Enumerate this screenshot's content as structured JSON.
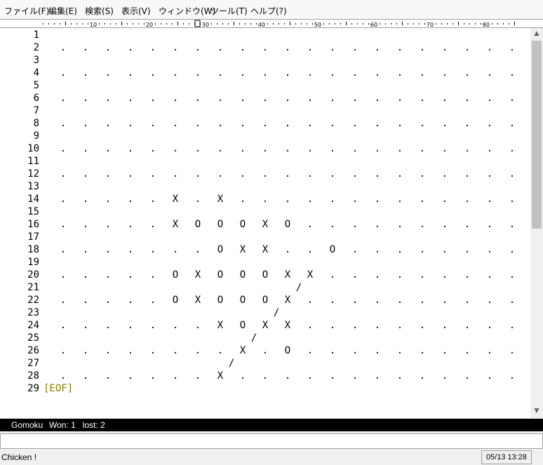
{
  "menu": [
    {
      "label": "ファイル(F)"
    },
    {
      "label": "編集(E)"
    },
    {
      "label": "検索(S)"
    },
    {
      "label": "表示(V)"
    },
    {
      "label": "ウィンドウ(W)"
    },
    {
      "label": "ツール(T)"
    },
    {
      "label": "ヘルプ(?)"
    }
  ],
  "ruler": {
    "labels": [
      "10",
      "20",
      "30",
      "40",
      "50",
      "60",
      "70",
      "80"
    ]
  },
  "editor": {
    "line_numbers": [
      "1",
      "2",
      "3",
      "4",
      "5",
      "6",
      "7",
      "8",
      "9",
      "10",
      "11",
      "12",
      "13",
      "14",
      "15",
      "16",
      "17",
      "18",
      "19",
      "20",
      "21",
      "22",
      "23",
      "24",
      "25",
      "26",
      "27",
      "28",
      "29"
    ],
    "board": {
      "symbols": [
        {
          "line": 14,
          "col": 5,
          "text": "X"
        },
        {
          "line": 14,
          "col": 7,
          "text": "X"
        },
        {
          "line": 16,
          "col": 5,
          "text": "X"
        },
        {
          "line": 16,
          "col": 6,
          "text": "O"
        },
        {
          "line": 16,
          "col": 7,
          "text": "O"
        },
        {
          "line": 16,
          "col": 8,
          "text": "O"
        },
        {
          "line": 16,
          "col": 9,
          "text": "X"
        },
        {
          "line": 16,
          "col": 10,
          "text": "O"
        },
        {
          "line": 18,
          "col": 7,
          "text": "O"
        },
        {
          "line": 18,
          "col": 8,
          "text": "X"
        },
        {
          "line": 18,
          "col": 9,
          "text": "X"
        },
        {
          "line": 18,
          "col": 12,
          "text": "O"
        },
        {
          "line": 20,
          "col": 5,
          "text": "O"
        },
        {
          "line": 20,
          "col": 6,
          "text": "X"
        },
        {
          "line": 20,
          "col": 7,
          "text": "O"
        },
        {
          "line": 20,
          "col": 8,
          "text": "O"
        },
        {
          "line": 20,
          "col": 9,
          "text": "O"
        },
        {
          "line": 20,
          "col": 10,
          "text": "X"
        },
        {
          "line": 20,
          "col": 11,
          "text": "X"
        },
        {
          "line": 22,
          "col": 5,
          "text": "O"
        },
        {
          "line": 22,
          "col": 6,
          "text": "X"
        },
        {
          "line": 22,
          "col": 7,
          "text": "O"
        },
        {
          "line": 22,
          "col": 8,
          "text": "O"
        },
        {
          "line": 22,
          "col": 9,
          "text": "O"
        },
        {
          "line": 22,
          "col": 10,
          "text": "X"
        },
        {
          "line": 24,
          "col": 7,
          "text": "X"
        },
        {
          "line": 24,
          "col": 8,
          "text": "O"
        },
        {
          "line": 24,
          "col": 9,
          "text": "X"
        },
        {
          "line": 24,
          "col": 10,
          "text": "X"
        },
        {
          "line": 26,
          "col": 8,
          "text": "X"
        },
        {
          "line": 26,
          "col": 10,
          "text": "O"
        },
        {
          "line": 28,
          "col": 7,
          "text": "X"
        }
      ],
      "slashes": [
        {
          "line": 21,
          "col": 10.5
        },
        {
          "line": 23,
          "col": 9.5
        },
        {
          "line": 25,
          "col": 8.5
        },
        {
          "line": 27,
          "col": 7.5
        }
      ],
      "empty_mark": ".",
      "slash_mark": "/"
    },
    "eof_marker": "[EOF]"
  },
  "status": {
    "mode_name": "Gomoku",
    "score": "Won: 1   lost: 2"
  },
  "bottom": {
    "message": "Chicken !",
    "datetime": "05/13 13:28"
  }
}
